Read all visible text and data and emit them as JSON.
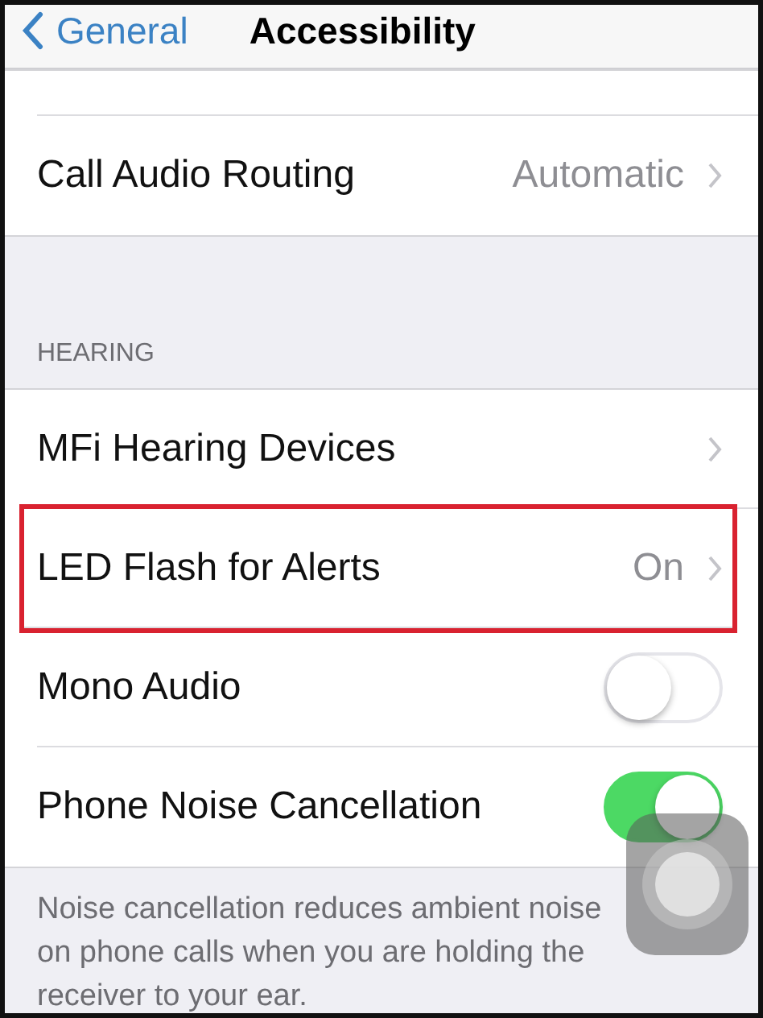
{
  "nav": {
    "back": "General",
    "title": "Accessibility"
  },
  "top_rows": [
    {
      "kind": "value",
      "label": "Call Audio Routing",
      "value": "Automatic",
      "highlighted": false
    }
  ],
  "section": {
    "header": "HEARING",
    "rows": [
      {
        "kind": "value",
        "label": "MFi Hearing Devices",
        "highlighted": false
      },
      {
        "kind": "value",
        "label": "LED Flash for Alerts",
        "value": "On",
        "highlighted": true
      },
      {
        "kind": "toggle",
        "label": "Mono Audio",
        "on": false,
        "highlighted": false
      },
      {
        "kind": "toggle",
        "label": "Phone Noise Cancellation",
        "on": true,
        "highlighted": false
      }
    ],
    "footer": "Noise cancellation reduces ambient noise on phone calls when you are holding the receiver to your ear."
  }
}
